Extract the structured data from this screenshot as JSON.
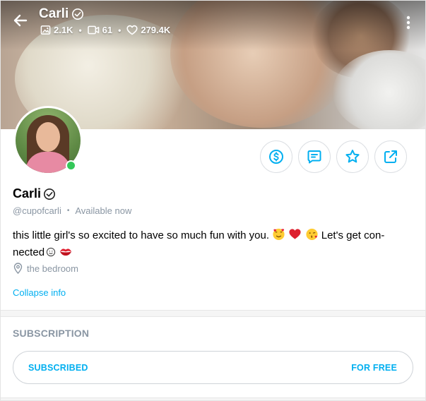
{
  "header": {
    "title": "Carli",
    "stats": {
      "photos": "2.1K",
      "videos": "61",
      "likes": "279.4K"
    }
  },
  "profile": {
    "name": "Carli",
    "handle": "@cupofcarli",
    "status": "Available now",
    "bio_line1": "this little girl's so excited to have so much fun with you.",
    "bio_line1_tail": "Let's get con-",
    "bio_line2": "nected",
    "location": "the bedroom",
    "collapse_label": "Collapse info"
  },
  "subscription": {
    "heading": "SUBSCRIPTION",
    "state_label": "SUBSCRIBED",
    "price_label": "FOR FREE"
  },
  "colors": {
    "accent": "#00aff0",
    "muted_text": "#8a96a3",
    "online": "#34c759"
  },
  "icons": {
    "back": "arrow-left-icon",
    "verified": "verified-badge-icon",
    "photos": "image-icon",
    "videos": "video-icon",
    "likes": "heart-icon",
    "more": "more-vertical-icon",
    "tip": "dollar-circle-icon",
    "message": "message-icon",
    "favorite": "star-icon",
    "share": "share-icon",
    "location": "location-pin-icon"
  }
}
